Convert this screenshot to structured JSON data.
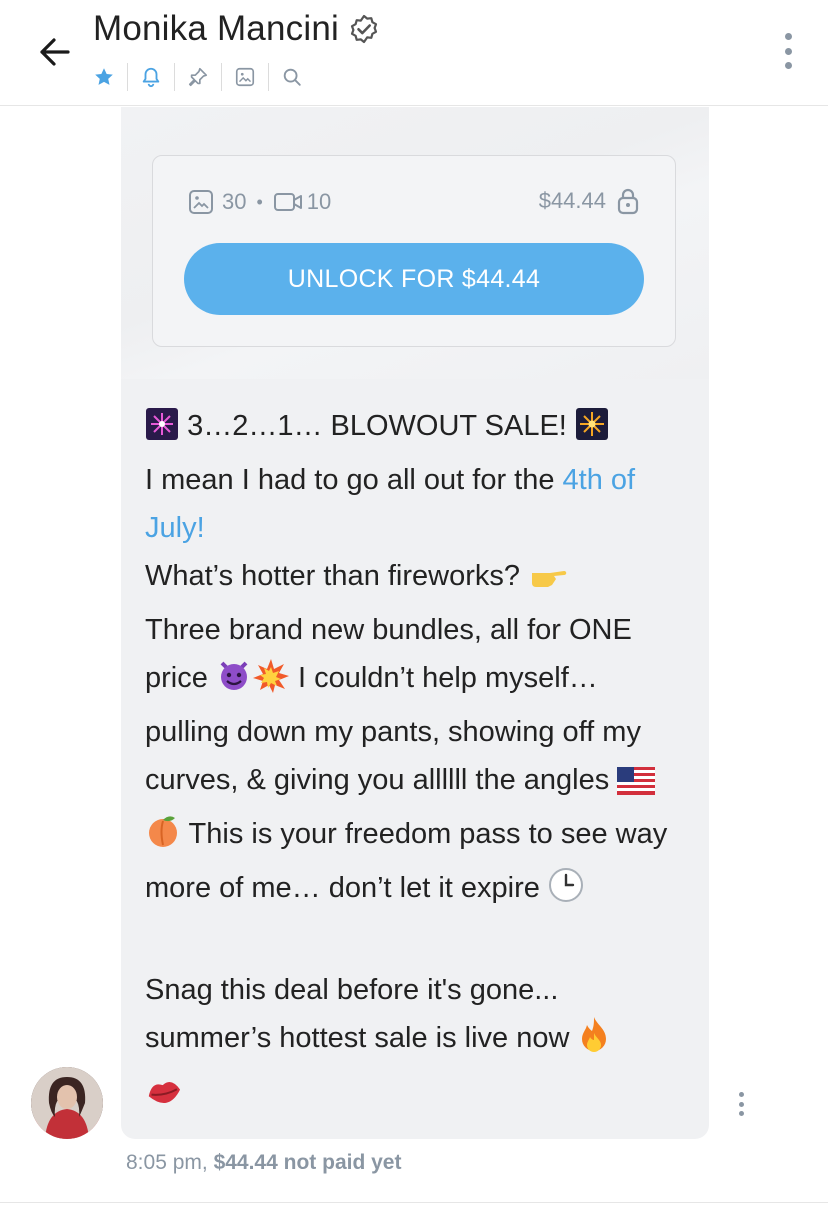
{
  "header": {
    "title": "Monika Mancini",
    "verified_icon": "verified-badge-icon",
    "actions": [
      {
        "name": "star-icon",
        "color": "#4ba3e3"
      },
      {
        "name": "bell-icon",
        "color": "#4ba3e3"
      },
      {
        "name": "pin-icon",
        "color": "#8a96a3"
      },
      {
        "name": "image-icon",
        "color": "#8a96a3"
      },
      {
        "name": "search-icon",
        "color": "#8a96a3"
      }
    ]
  },
  "locked_media": {
    "photo_count": "30",
    "video_count": "10",
    "price": "$44.44",
    "unlock_label": "UNLOCK FOR $44.44"
  },
  "message": {
    "line1": "3…2…1… BLOWOUT SALE!",
    "line2a": "I mean I had to go all out for the ",
    "line2_highlight": "4th of July!",
    "line3": "What’s hotter than fireworks? ",
    "line4a": "Three brand new bundles, all for ONE price ",
    "line4b": " I couldn’t help myself… pulling down my pants, showing off my curves, & giving you allllll the angles ",
    "line4c": " This is your freedom pass to see way more of me… don’t let it expire ",
    "line5": "Snag this deal before it's gone... summer’s hottest sale is live now "
  },
  "footer": {
    "time": "8:05 pm,",
    "price_status": "$44.44",
    "status_text": "not paid yet"
  },
  "colors": {
    "accent": "#5bb1ec",
    "link": "#4ba3e3",
    "muted": "#8a96a3",
    "bubble": "#f0f1f3"
  }
}
